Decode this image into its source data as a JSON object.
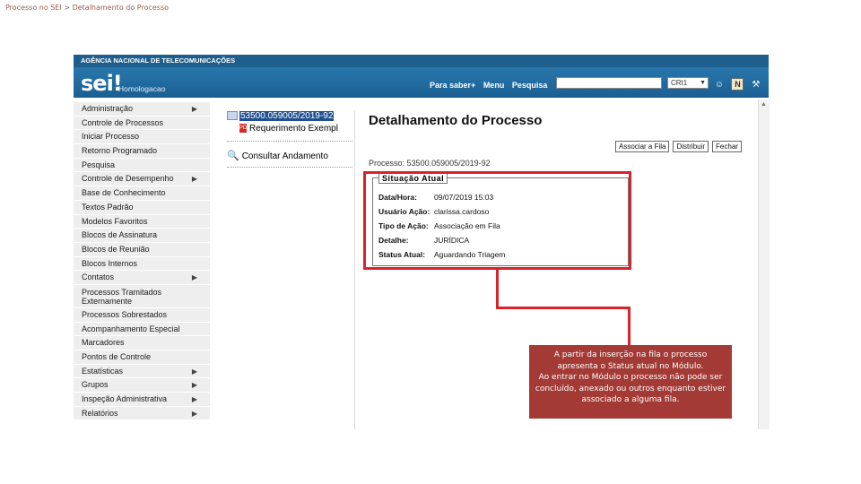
{
  "slide_title": "Processo no SEI > Detalhamento do Processo",
  "app": {
    "org_name": "AGÊNCIA NACIONAL DE TELECOMUNICAÇÕES",
    "logo": "sei!",
    "environment": "Homologacao",
    "nav": {
      "para_saber": "Para saber+",
      "menu": "Menu",
      "pesquisa": "Pesquisa"
    },
    "search_value": "",
    "org_select": "CRI1",
    "tools": [
      "user-icon",
      "notes-icon",
      "tools-icon",
      "exit-icon"
    ]
  },
  "sidebar": {
    "items": [
      {
        "label": "Administração",
        "submenu": true
      },
      {
        "label": "Controle de Processos",
        "submenu": false
      },
      {
        "label": "Iniciar Processo",
        "submenu": false
      },
      {
        "label": "Retorno Programado",
        "submenu": false
      },
      {
        "label": "Pesquisa",
        "submenu": false
      },
      {
        "label": "Controle de Desempenho",
        "submenu": true
      },
      {
        "label": "Base de Conhecimento",
        "submenu": false
      },
      {
        "label": "Textos Padrão",
        "submenu": false
      },
      {
        "label": "Modelos Favoritos",
        "submenu": false
      },
      {
        "label": "Blocos de Assinatura",
        "submenu": false
      },
      {
        "label": "Blocos de Reunião",
        "submenu": false
      },
      {
        "label": "Blocos Internos",
        "submenu": false
      },
      {
        "label": "Contatos",
        "submenu": true
      },
      {
        "label": "Processos Tramitados Externamente",
        "submenu": false
      },
      {
        "label": "Processos Sobrestados",
        "submenu": false
      },
      {
        "label": "Acompanhamento Especial",
        "submenu": false
      },
      {
        "label": "Marcadores",
        "submenu": false
      },
      {
        "label": "Pontos de Controle",
        "submenu": false
      },
      {
        "label": "Estatísticas",
        "submenu": true
      },
      {
        "label": "Grupos",
        "submenu": true
      },
      {
        "label": "Inspeção Administrativa",
        "submenu": true
      },
      {
        "label": "Relatórios",
        "submenu": true
      }
    ]
  },
  "tree": {
    "process_number": "53500.059005/2019-92",
    "document": "Requerimento Exempl",
    "consult": "Consultar Andamento"
  },
  "content": {
    "title": "Detalhamento do Processo",
    "actions": {
      "associar": "Associar a Fila",
      "distribuir": "Distribuir",
      "fechar": "Fechar"
    },
    "processo_label": "Processo:",
    "processo_value": "53500.059005/2019-92",
    "situacao": {
      "legend": "Situação Atual",
      "rows": [
        {
          "label": "Data/Hora:",
          "value": "09/07/2019 15:03"
        },
        {
          "label": "Usuário Ação:",
          "value": "clarissa.cardoso"
        },
        {
          "label": "Tipo de Ação:",
          "value": "Associação em Fila"
        },
        {
          "label": "Detalhe:",
          "value": "JURÍDICA"
        },
        {
          "label": "Status Atual:",
          "value": "Aguardando Triagem"
        }
      ]
    }
  },
  "callout": {
    "line1": "A partir da inserção na fila o processo apresenta o Status atual no Módulo.",
    "line2": "Ao entrar no Módulo o processo não pode ser concluído, anexado ou outros enquanto estiver associado a alguma fila."
  },
  "colors": {
    "header_blue": "#1e5e8c",
    "highlight_red": "#d9232a",
    "callout_bg": "#a33a35",
    "selected_process": "#1f4f8f"
  }
}
